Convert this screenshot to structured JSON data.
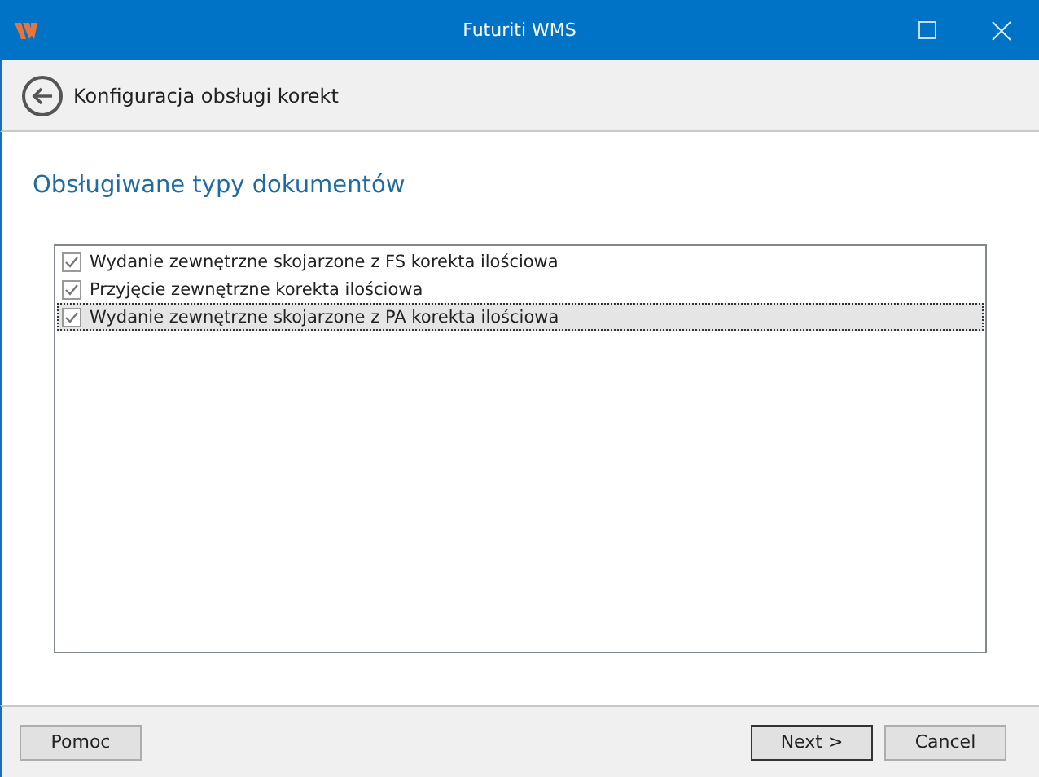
{
  "window": {
    "title": "Futuriti WMS"
  },
  "header": {
    "title": "Konfiguracja obsługi korekt"
  },
  "section": {
    "title": "Obsługiwane typy dokumentów"
  },
  "document_types": [
    {
      "label": "Wydanie zewnętrzne skojarzone z FS korekta ilościowa",
      "checked": true,
      "selected": false
    },
    {
      "label": "Przyjęcie zewnętrzne korekta ilościowa",
      "checked": true,
      "selected": false
    },
    {
      "label": "Wydanie zewnętrzne skojarzone z PA korekta ilościowa",
      "checked": true,
      "selected": true
    }
  ],
  "footer": {
    "help_button": "Pomoc",
    "next_button": "Next >",
    "cancel_button": "Cancel"
  }
}
